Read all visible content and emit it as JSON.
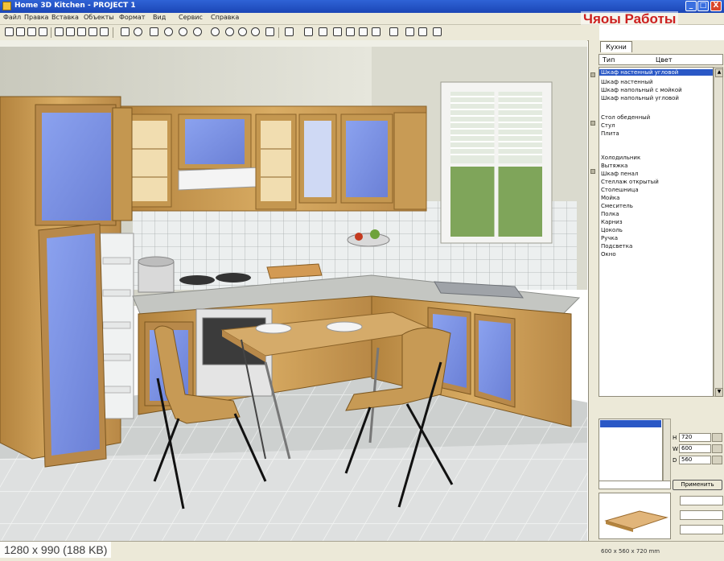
{
  "window": {
    "title": "Home 3D Kitchen - PROJECT 1",
    "min_glyph": "_",
    "max_glyph": "□",
    "close_glyph": "X"
  },
  "menu": [
    "Файл",
    "Правка",
    "Вставка",
    "Объекты",
    "Формат",
    "Вид",
    "Сервис",
    "Справка"
  ],
  "toolbar": {
    "icons": [
      "new-icon",
      "open-icon",
      "save-icon",
      "print-icon",
      "cut-icon",
      "copy-icon",
      "paste-icon",
      "undo-icon",
      "redo-icon",
      "info-icon",
      "rotate-icon",
      "move-icon",
      "zoom-in-icon",
      "zoom-out-icon",
      "pan-icon",
      "zoom-fit-icon",
      "zoom-window-icon",
      "wall-icon",
      "door-icon",
      "window-icon",
      "grid-icon",
      "camera-icon",
      "measure-icon",
      "light-icon"
    ]
  },
  "watermark": "Чяоы Работы",
  "caption": "1280 x 990 (188 KB)",
  "panel": {
    "tab_label": "Кухни",
    "head_left": "Тип",
    "head_right": "Цвет",
    "list_items": [
      "Шкаф настенный угловой",
      "Шкаф настенный",
      "Шкаф напольный с мойкой",
      "Шкаф напольный угловой",
      "Стол обеденный",
      "Стул",
      "Плита",
      "Холодильник",
      "Вытяжка",
      "Шкаф пенал",
      "Стеллаж открытый",
      "Столешница",
      "Мойка",
      "Смеситель",
      "Полка",
      "Карниз",
      "Цоколь",
      "Ручка",
      "Подсветка",
      "Окно"
    ],
    "params": [
      "H",
      "W",
      "D"
    ],
    "param_values": [
      "720",
      "600",
      "560"
    ],
    "apply_label": "Применить",
    "status_right": "600 x 560 x 720 mm"
  },
  "colors": {
    "titlebar": "#1f4fc4",
    "wood": "#c8a05e",
    "panel_blue": "#6f7fd2",
    "wall": "#dcdcce",
    "floor": "#c9cccb"
  }
}
